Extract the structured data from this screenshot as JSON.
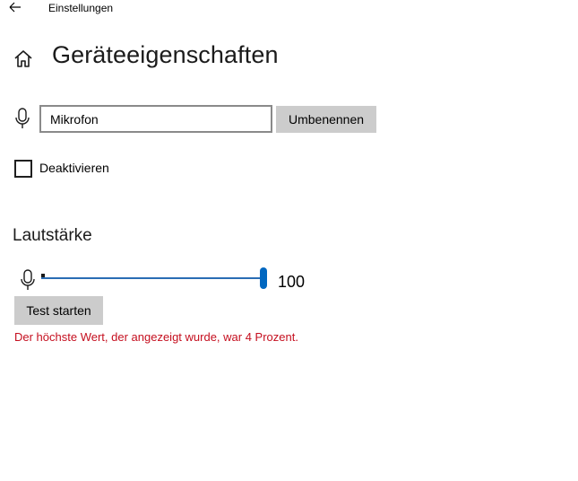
{
  "window": {
    "title": "Einstellungen"
  },
  "page": {
    "title": "Geräteeigenschaften"
  },
  "device": {
    "name_value": "Mikrofon",
    "rename_label": "Umbenennen",
    "disable_label": "Deaktivieren",
    "disabled": false
  },
  "volume": {
    "section_title": "Lautstärke",
    "value": 100,
    "value_text": "100",
    "peak_percent": 4,
    "test_label": "Test starten",
    "peak_message": "Der höchste Wert, der angezeigt wurde, war 4 Prozent."
  },
  "colors": {
    "accent": "#0067c0",
    "button_bg": "#cccccc",
    "error_text": "#c50f1f"
  },
  "icons": {
    "back": "back-arrow-icon",
    "home": "home-icon",
    "mic": "microphone-icon"
  }
}
